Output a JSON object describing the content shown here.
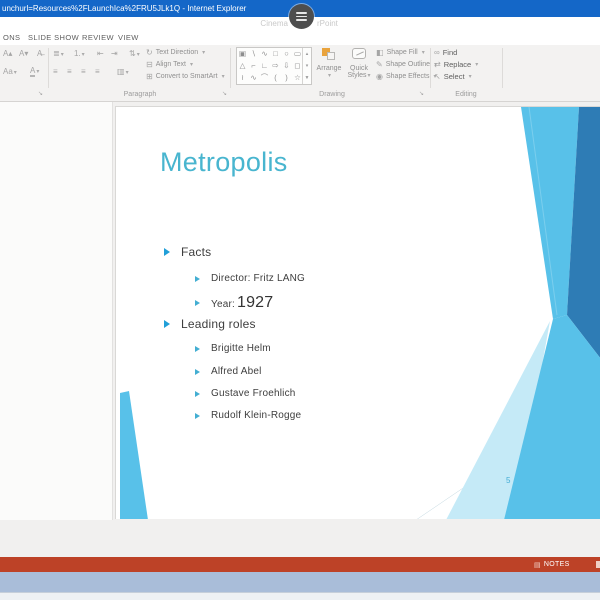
{
  "window": {
    "title": "unchurl=Resources%2FLaunchIca%2FRU5JLk1Q - Internet Explorer"
  },
  "overlay": {
    "left_text": "Cinema",
    "right_text": "rPoint"
  },
  "ribbon": {
    "tabs": [
      {
        "label": "ONS"
      },
      {
        "label": "SLIDE SHOW"
      },
      {
        "label": "REVIEW"
      },
      {
        "label": "VIEW"
      }
    ],
    "paragraph_group": {
      "label": "Paragraph",
      "text_direction": "Text Direction",
      "align_text": "Align Text",
      "convert_smartart": "Convert to SmartArt"
    },
    "drawing_group": {
      "label": "Drawing",
      "arrange": "Arrange",
      "quick_styles_line1": "Quick",
      "quick_styles_line2": "Styles",
      "shape_fill": "Shape Fill",
      "shape_outline": "Shape Outline",
      "shape_effects": "Shape Effects",
      "gallery": [
        [
          "▣",
          "∖",
          "∿",
          "□",
          "○",
          "▭"
        ],
        [
          "△",
          "⌐",
          "∟",
          "⇨",
          "⇩",
          "◻"
        ],
        [
          "≀",
          "∿",
          "⌒",
          "(",
          ")",
          "☆"
        ]
      ]
    },
    "editing_group": {
      "label": "Editing",
      "find": "Find",
      "replace": "Replace",
      "select": "Select"
    }
  },
  "icons": {
    "grow_font": "A▴",
    "shrink_font": "A▾",
    "clear_formatting": "A̶",
    "change_case": "Aa",
    "font_color": "A",
    "dropdown": "▾",
    "bullets": "≣",
    "numbering": "1.",
    "indent_decrease": "⇤",
    "indent_increase": "⇥",
    "line_spacing": "⇅",
    "align_left": "≡",
    "align_center": "≡",
    "align_right": "≡",
    "justify": "≡",
    "columns": "▥",
    "text_direction": "↻",
    "align_text": "⊟",
    "smartart": "⊞",
    "shape_fill": "◧",
    "shape_outline": "✎",
    "shape_effects": "◉",
    "find": "∞",
    "replace": "⇄",
    "select": "↖",
    "launcher": "↘",
    "gallery_up": "▴",
    "gallery_down": "▾",
    "gallery_more": "▼",
    "notes": "▤"
  },
  "slide": {
    "title": "Metropolis",
    "facts_heading": "Facts",
    "facts": [
      {
        "text": "Director: Fritz LANG"
      }
    ],
    "year_label": "Year:",
    "year_value": "1927",
    "roles_heading": "Leading roles",
    "roles": [
      {
        "text": "Brigitte Helm"
      },
      {
        "text": "Alfred Abel"
      },
      {
        "text": "Gustave Froehlich"
      },
      {
        "text": "Rudolf Klein-Rogge"
      }
    ],
    "page_number": "5"
  },
  "status_bar": {
    "notes": "NOTES"
  },
  "colors": {
    "titlebar": "#1467c8",
    "accent_light": "#58c1e9",
    "accent_dark": "#2e7cb5",
    "accent_pale": "#c5eaf7",
    "status_bar": "#bd4227",
    "taskbar": "#a9bdd9",
    "slide_title": "#48b5cf",
    "bullet_l1": "#219fd8",
    "bullet_l2": "#43aed2"
  }
}
